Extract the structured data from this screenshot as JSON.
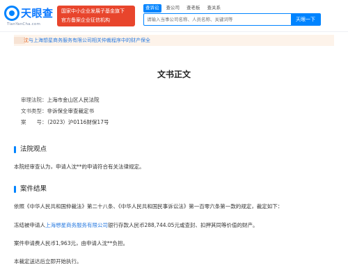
{
  "header": {
    "logo_text": "天眼查",
    "logo_sub": "TianYanCha.com",
    "promo_line1": "国家中小企业发展子基金旗下",
    "promo_line2": "官方备案企业征信机构",
    "tabs": [
      "查诉讼",
      "查公司",
      "查老板",
      "查关系"
    ],
    "search_placeholder": "请输入当事公司名称、人员名称、关键词等",
    "search_button": "天眼一下"
  },
  "notice": {
    "prefix": "沈",
    "link_text": "与上海想星商务服务有限公司相关仲裁程序中的财产保全"
  },
  "document": {
    "title": "文书正文",
    "meta": [
      {
        "label": "审理法院：",
        "value": "上海市金山区人民法院"
      },
      {
        "label": "文书类型：",
        "value": "非诉保全审查裁定书"
      },
      {
        "label": "案　　号：",
        "value": "（2023）沪0116财保17号"
      }
    ],
    "section1_title": "法院观点",
    "section1_text": "本院经审查认为，申请人沈**的申请符合有关法律规定。",
    "section2_title": "案件结果",
    "result_p1": "依照《中华人民共和国仲裁法》第二十八条、《中华人民共和国民事诉讼法》第一百零六条第一款的规定，裁定如下：",
    "result_p2_pre": "冻结被申请人",
    "result_p2_link": "上海想星商务服务有限公司",
    "result_p2_post": "银行存款人民币288,744.05元或查封、扣押其同等价值的财产。",
    "result_p3": "案件申请费人民币1,963元，由申请人沈**负担。",
    "result_p4": "本裁定送达后立即开始执行。"
  },
  "colors": {
    "brand_blue": "#0084ff",
    "promo_red": "#e8452c",
    "link_blue": "#2a7be0",
    "notice_orange": "#e26a2c"
  }
}
